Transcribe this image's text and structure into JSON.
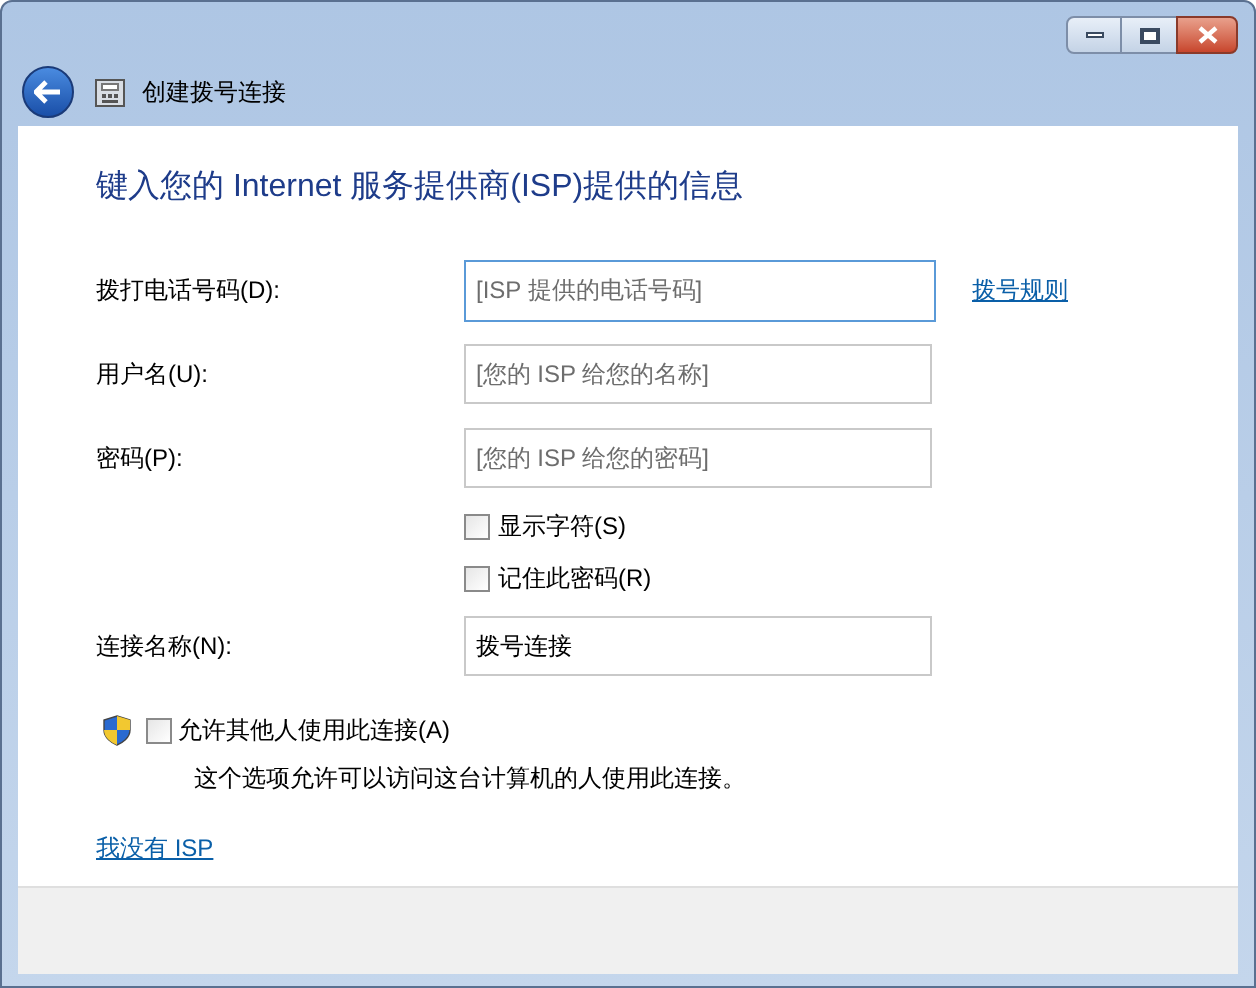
{
  "window": {
    "title": "创建拨号连接"
  },
  "heading": "键入您的 Internet 服务提供商(ISP)提供的信息",
  "rows": [
    {
      "kind": "field",
      "label": "拨打电话号码(D):",
      "placeholder": "[ISP 提供的电话号码]",
      "focused": true,
      "link": "拨号规则"
    },
    {
      "kind": "field",
      "label": "用户名(U):",
      "placeholder": "[您的 ISP 给您的名称]",
      "focused": false
    },
    {
      "kind": "field",
      "label": "密码(P):",
      "placeholder": "[您的 ISP 给您的密码]",
      "focused": false
    },
    {
      "kind": "checkbox",
      "label": "显示字符(S)",
      "checked": false
    },
    {
      "kind": "checkbox",
      "label": "记住此密码(R)",
      "checked": false
    },
    {
      "kind": "field",
      "label": "连接名称(N):",
      "value": "拨号连接",
      "focused": false
    }
  ],
  "share": {
    "label": "允许其他人使用此连接(A)",
    "checked": false,
    "description": "这个选项允许可以访问这台计算机的人使用此连接。"
  },
  "no_isp_link": "我没有 ISP"
}
